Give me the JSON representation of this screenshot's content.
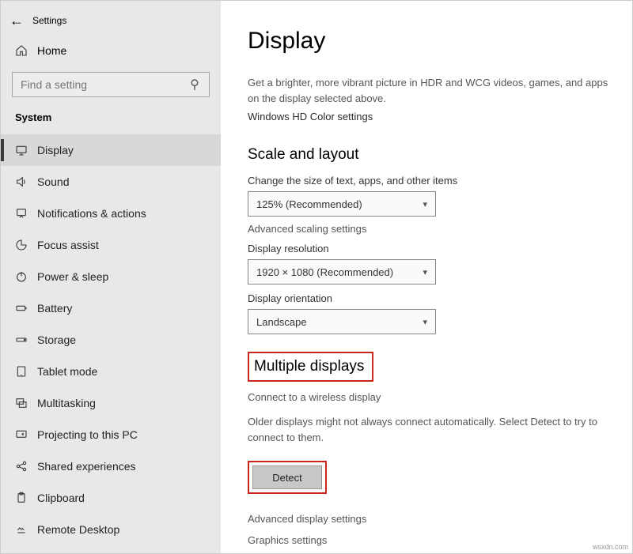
{
  "header": {
    "back_glyph": "←",
    "window_title": "Settings"
  },
  "home": {
    "label": "Home"
  },
  "search": {
    "placeholder": "Find a setting"
  },
  "category": "System",
  "nav": [
    {
      "icon": "display-icon",
      "label": "Display",
      "selected": true
    },
    {
      "icon": "sound-icon",
      "label": "Sound"
    },
    {
      "icon": "notifications-icon",
      "label": "Notifications & actions"
    },
    {
      "icon": "focus-icon",
      "label": "Focus assist"
    },
    {
      "icon": "power-icon",
      "label": "Power & sleep"
    },
    {
      "icon": "battery-icon",
      "label": "Battery"
    },
    {
      "icon": "storage-icon",
      "label": "Storage"
    },
    {
      "icon": "tablet-icon",
      "label": "Tablet mode"
    },
    {
      "icon": "multitask-icon",
      "label": "Multitasking"
    },
    {
      "icon": "projecting-icon",
      "label": "Projecting to this PC"
    },
    {
      "icon": "shared-icon",
      "label": "Shared experiences"
    },
    {
      "icon": "clipboard-icon",
      "label": "Clipboard"
    },
    {
      "icon": "remote-icon",
      "label": "Remote Desktop"
    }
  ],
  "main": {
    "title": "Display",
    "hdr_desc": "Get a brighter, more vibrant picture in HDR and WCG videos, games, and apps on the display selected above.",
    "hdr_link": "Windows HD Color settings",
    "scale_title": "Scale and layout",
    "scale_label": "Change the size of text, apps, and other items",
    "scale_value": "125% (Recommended)",
    "adv_scale": "Advanced scaling settings",
    "res_label": "Display resolution",
    "res_value": "1920 × 1080 (Recommended)",
    "orient_label": "Display orientation",
    "orient_value": "Landscape",
    "multi_title": "Multiple displays",
    "wireless": "Connect to a wireless display",
    "detect_desc": "Older displays might not always connect automatically. Select Detect to try to connect to them.",
    "detect_btn": "Detect",
    "adv_disp": "Advanced display settings",
    "graphics": "Graphics settings"
  },
  "watermark": "wsxdn.com"
}
